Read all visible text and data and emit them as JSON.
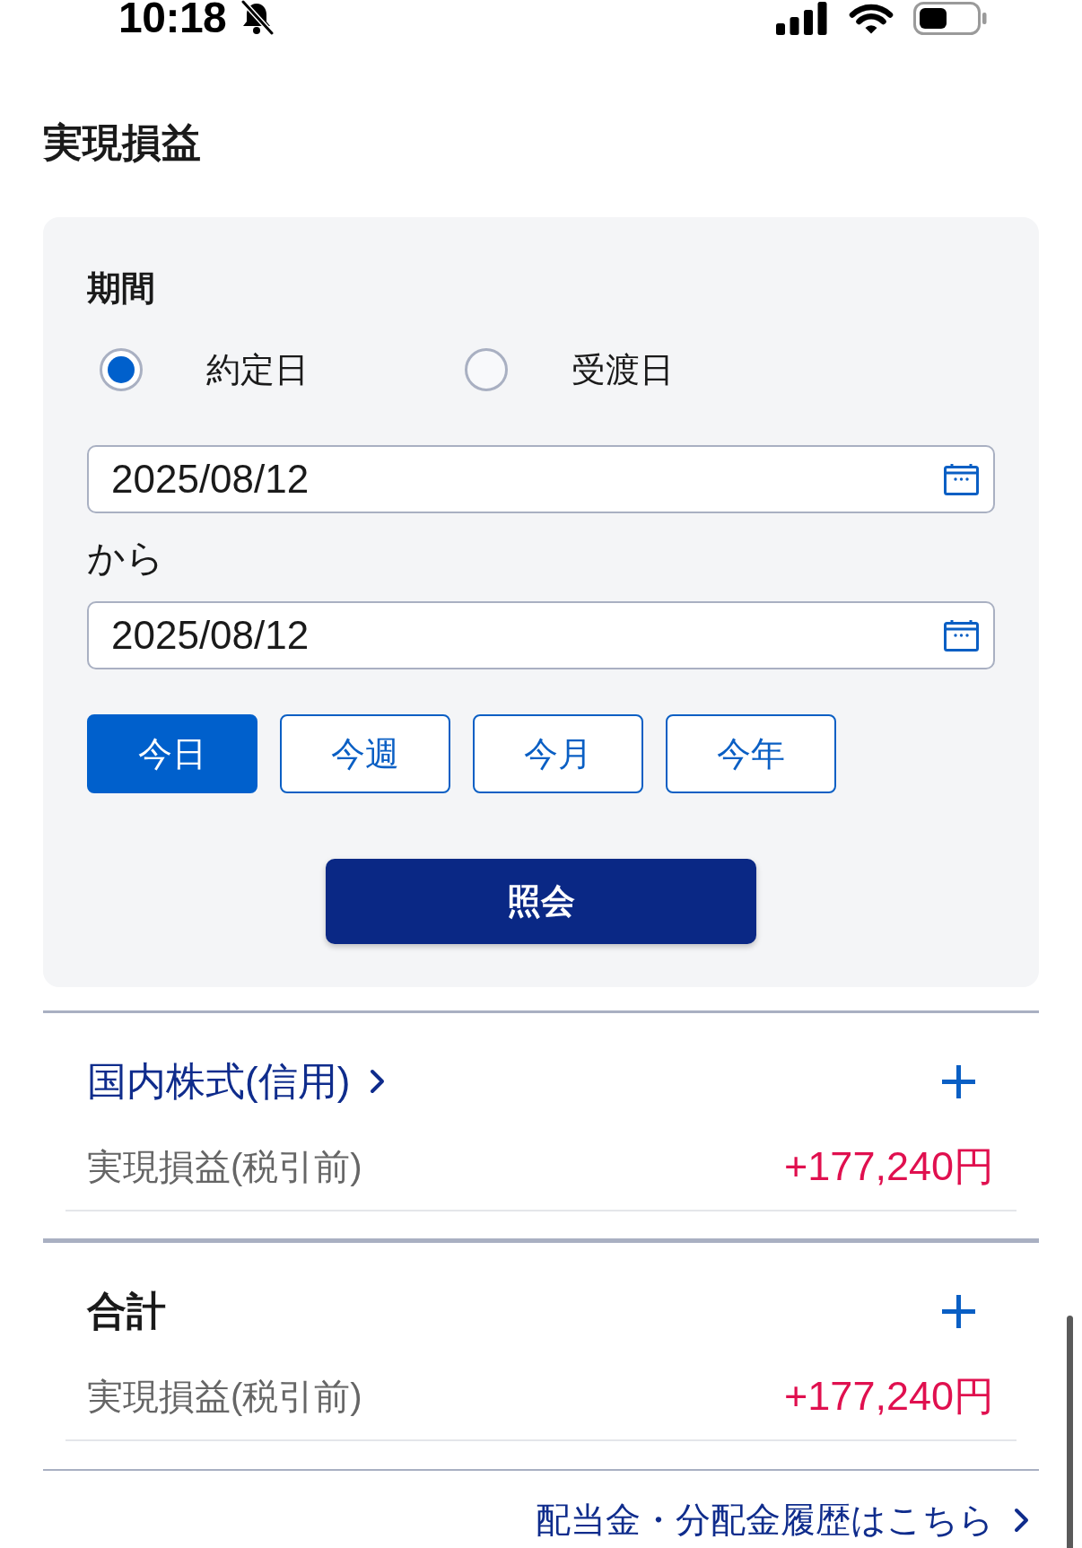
{
  "status_bar": {
    "time": "10:18"
  },
  "page_title": "実現損益",
  "filter": {
    "label": "期間",
    "date_basis": [
      {
        "label": "約定日",
        "selected": true
      },
      {
        "label": "受渡日",
        "selected": false
      }
    ],
    "from_date": {
      "value": "2025/08/12"
    },
    "from_suffix": "から",
    "to_date": {
      "value": "2025/08/12"
    },
    "presets": [
      {
        "label": "今日",
        "selected": true
      },
      {
        "label": "今週",
        "selected": false
      },
      {
        "label": "今月",
        "selected": false
      },
      {
        "label": "今年",
        "selected": false
      }
    ],
    "submit_button": "照会"
  },
  "sections": [
    {
      "kind": "category",
      "title": "国内株式(信用)",
      "expanded": false,
      "rows": [
        {
          "label": "実現損益(税引前)",
          "value": "+177,240円"
        }
      ]
    },
    {
      "kind": "total",
      "title": "合計",
      "expanded": false,
      "rows": [
        {
          "label": "実現損益(税引前)",
          "value": "+177,240円"
        }
      ]
    }
  ],
  "footer_link": "配当金・分配金履歴はこちら"
}
